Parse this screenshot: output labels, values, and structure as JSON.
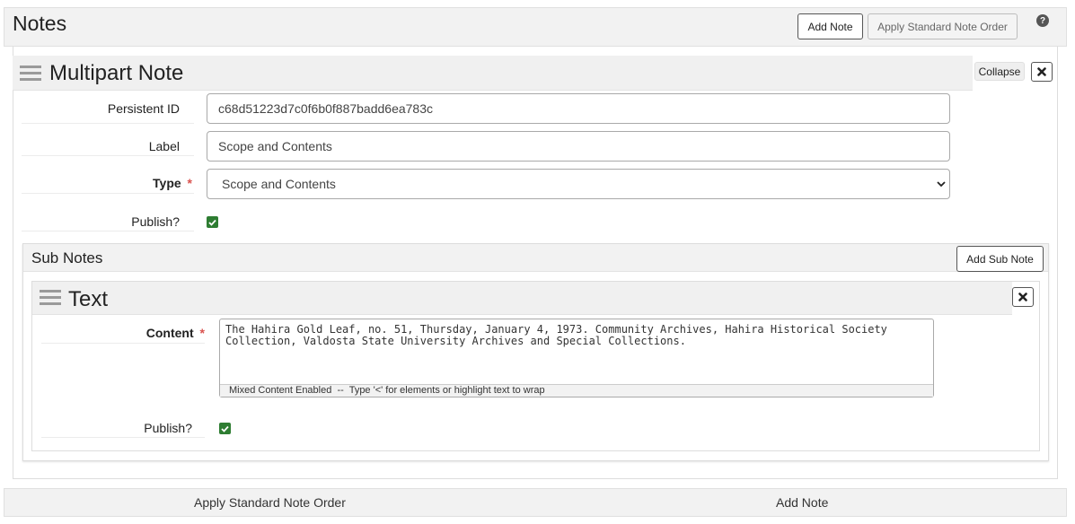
{
  "header": {
    "title": "Notes",
    "add_note_label": "Add Note",
    "apply_order_label": "Apply Standard Note Order",
    "help_icon": "question-circle-icon"
  },
  "note": {
    "title": "Multipart Note",
    "collapse_label": "Collapse",
    "persistent_id_label": "Persistent ID",
    "persistent_id_value": "c68d51223d7c0f6b0f887badd6ea783c",
    "label_label": "Label",
    "label_value": "Scope and Contents",
    "type_label": "Type",
    "type_value": "Scope and Contents",
    "publish_label": "Publish?",
    "publish_checked": true
  },
  "subnotes": {
    "title": "Sub Notes",
    "add_label": "Add Sub Note",
    "text_note": {
      "title": "Text",
      "content_label": "Content",
      "content_value": "The Hahira Gold Leaf, no. 51, Thursday, January 4, 1973. Community Archives, Hahira Historical Society Collection, Valdosta State University Archives and Special Collections.",
      "mixed_content_hint": "Mixed Content Enabled  --  Type '<' for elements or highlight text to wrap",
      "publish_label": "Publish?",
      "publish_checked": true
    }
  },
  "footer": {
    "apply_order_label": "Apply Standard Note Order",
    "add_note_label": "Add Note"
  },
  "colors": {
    "header_bg": "#f2f2f2",
    "border": "#dddddd",
    "check_green": "#2e7d32",
    "required_red": "#d9534f"
  }
}
